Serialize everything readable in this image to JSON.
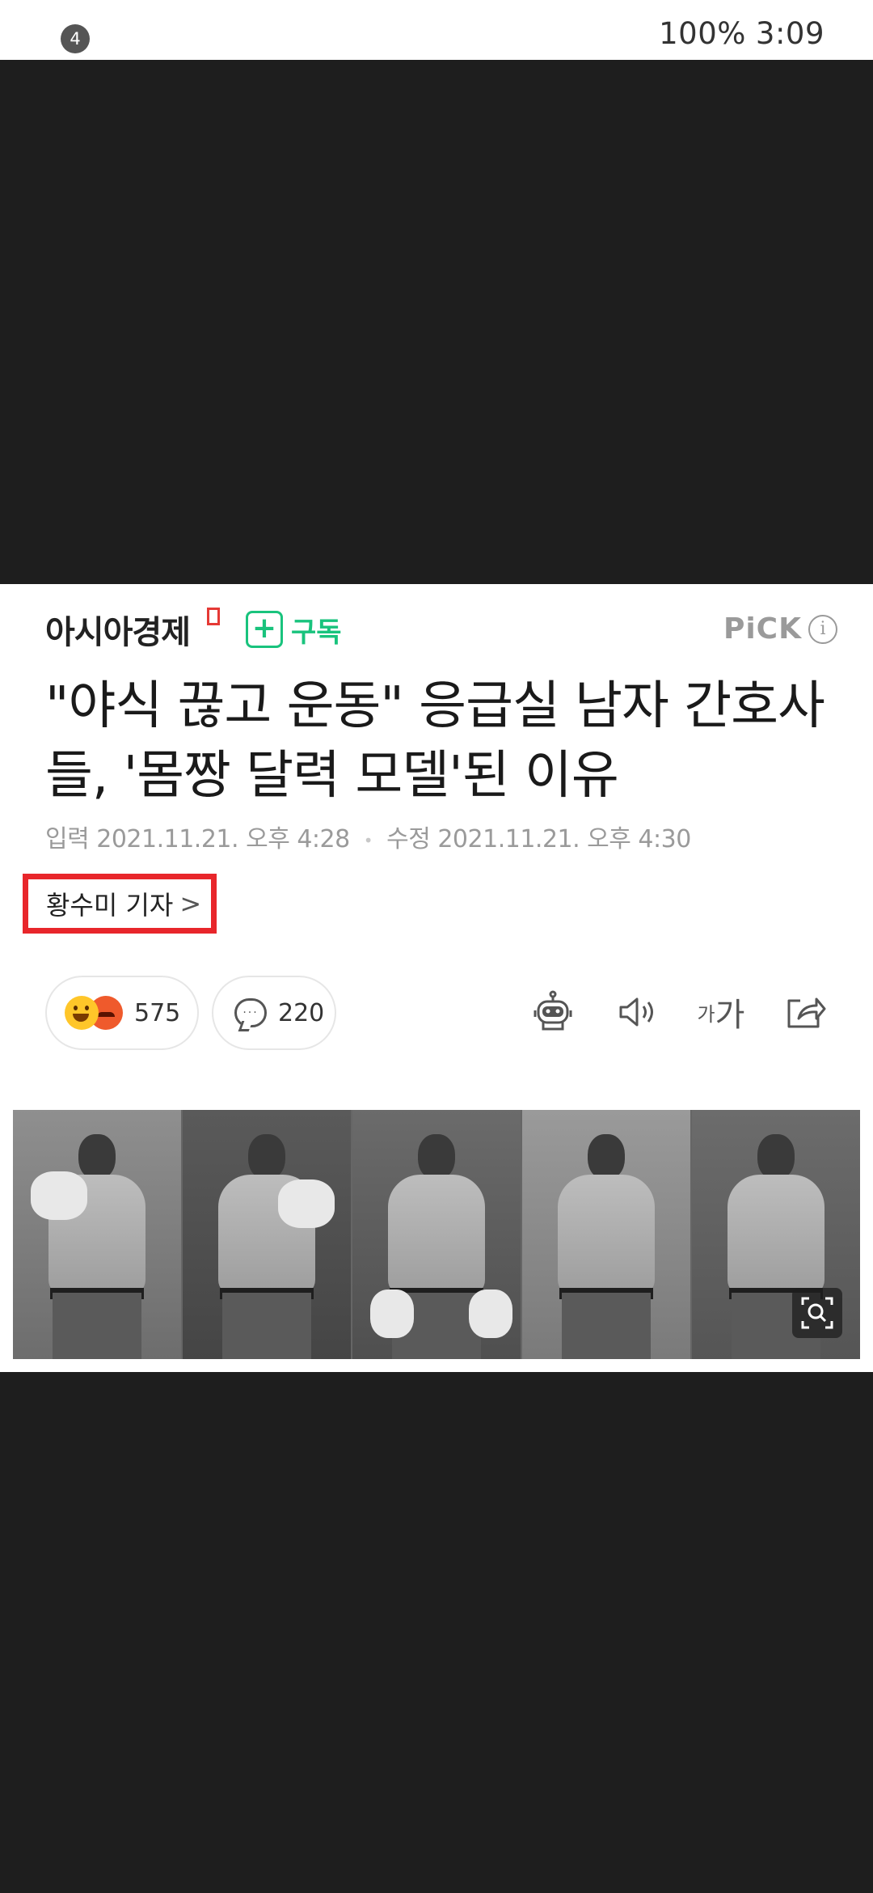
{
  "status_bar": {
    "notification_count": "4",
    "battery": "100%",
    "time": "3:09"
  },
  "article": {
    "publisher": "아시아경제",
    "subscribe_label": "구독",
    "subscribe_plus": "+",
    "pick_label": "PiCK",
    "pick_info": "i",
    "headline_line1": "\"야식 끊고 운동\" 응급실 남자 간호사",
    "headline_line2": "들, '몸짱 달력 모델'된 이유",
    "input_label": "입력",
    "input_datetime": "2021.11.21. 오후 4:28",
    "modified_label": "수정",
    "modified_datetime": "2021.11.21. 오후 4:30",
    "reporter": "황수미 기자",
    "reporter_chevron": ">",
    "reaction_count": "575",
    "comment_count": "220",
    "font_size_small": "가",
    "font_size_large": "가"
  },
  "icons": [
    "notification-badge",
    "publisher-flag-icon",
    "subscribe-plus-icon",
    "info-icon",
    "smile-emoji-icon",
    "angry-emoji-icon",
    "comment-icon",
    "summary-bot-icon",
    "speaker-icon",
    "font-size-icon",
    "share-icon",
    "zoom-search-icon"
  ],
  "colors": {
    "subscribe_green": "#19c37d",
    "highlight_red": "#e8262b",
    "background_dark": "#1e1e1e"
  }
}
